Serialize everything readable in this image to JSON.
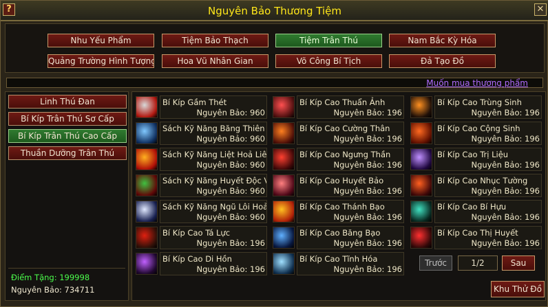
{
  "window": {
    "title": "Nguyên Bảo Thương Tiệm",
    "help_label": "?",
    "close_label": "✕"
  },
  "tabs": [
    {
      "label": "Nhu Yếu Phẩm",
      "active": false
    },
    {
      "label": "Tiệm Bảo Thạch",
      "active": false
    },
    {
      "label": "Tiệm Trân Thú",
      "active": true
    },
    {
      "label": "Nam Bắc Kỳ Hóa",
      "active": false
    },
    {
      "label": "Quảng Trường Hình Tượng",
      "active": false
    },
    {
      "label": "Hoa Vũ Nhân Gian",
      "active": false
    },
    {
      "label": "Võ Công Bí Tịch",
      "active": false
    },
    {
      "label": "Đả Tạo Đồ",
      "active": false
    }
  ],
  "notice": "Muốn mua thương phẩm",
  "categories": [
    {
      "label": "Linh Thú Đan",
      "active": false
    },
    {
      "label": "Bí Kíp Trân Thú Sơ Cấp",
      "active": false
    },
    {
      "label": "Bí Kíp Trân Thú Cao Cấp",
      "active": true
    },
    {
      "label": "Thuần Dưỡng Trân Thú",
      "active": false
    }
  ],
  "stats": {
    "diem_tang": "Điểm Tặng: 199998",
    "nguyen_bao": "Nguyên Bảo: 734711"
  },
  "items": [
    {
      "name": "Bí Kíp Gầm Thét",
      "price": "Nguyên Bảo: 960",
      "icon": "roar-icon",
      "colors": [
        "#d8d8d8",
        "#b01810"
      ]
    },
    {
      "name": "Bí Kíp Cao Thuẩn Ảnh",
      "price": "Nguyên Bảo: 196",
      "icon": "red-swirl-icon",
      "colors": [
        "#ff5050",
        "#501010"
      ]
    },
    {
      "name": "Bí Kíp Cao Trùng Sinh",
      "price": "Nguyên Bảo: 196",
      "icon": "rebirth-icon",
      "colors": [
        "#ff9020",
        "#201008"
      ]
    },
    {
      "name": "Sách Kỹ Năng Băng Thiên Tr",
      "price": "Nguyên Bảo: 960",
      "icon": "ice-sky-icon",
      "colors": [
        "#80c8ff",
        "#103060"
      ]
    },
    {
      "name": "Bí Kíp Cao Cường Thân",
      "price": "Nguyên Bảo: 196",
      "icon": "strong-body-icon",
      "colors": [
        "#ff8020",
        "#501008"
      ]
    },
    {
      "name": "Bí Kíp Cao Cộng Sinh",
      "price": "Nguyên Bảo: 196",
      "icon": "symbiosis-icon",
      "colors": [
        "#ff6a20",
        "#601000"
      ]
    },
    {
      "name": "Sách Kỹ Năng Liệt Hoả Liêu",
      "price": "Nguyên Bảo: 960",
      "icon": "fire-icon",
      "colors": [
        "#ffb020",
        "#b01008"
      ]
    },
    {
      "name": "Bí Kíp Cao Ngưng Thần",
      "price": "Nguyên Bảo: 196",
      "icon": "focus-icon",
      "colors": [
        "#ff4030",
        "#400808"
      ]
    },
    {
      "name": "Bí Kíp Cao Trị Liệu",
      "price": "Nguyên Bảo: 196",
      "icon": "heal-icon",
      "colors": [
        "#c090ff",
        "#200840"
      ]
    },
    {
      "name": "Sách Kỹ Năng Huyết Độc Vạn",
      "price": "Nguyên Bảo: 960",
      "icon": "poison-claw-icon",
      "colors": [
        "#40c040",
        "#600808"
      ]
    },
    {
      "name": "Bí Kíp Cao Huyết Bảo",
      "price": "Nguyên Bảo: 196",
      "icon": "blood-storm-icon",
      "colors": [
        "#ff8080",
        "#500818"
      ]
    },
    {
      "name": "Bí Kíp Cao Nhục Tường",
      "price": "Nguyên Bảo: 196",
      "icon": "flesh-wall-icon",
      "colors": [
        "#ff6020",
        "#400808"
      ]
    },
    {
      "name": "Sách Kỹ Năng Ngũ Lôi Hoản",
      "price": "Nguyên Bảo: 960",
      "icon": "thunder-icon",
      "colors": [
        "#e0e8ff",
        "#182050"
      ]
    },
    {
      "name": "Bí Kíp Cao Thánh Bạo",
      "price": "Nguyên Bảo: 196",
      "icon": "holy-burst-icon",
      "colors": [
        "#ffc020",
        "#b02008"
      ]
    },
    {
      "name": "Bí Kíp Cao Bí Hựu",
      "price": "Nguyên Bảo: 196",
      "icon": "blessing-icon",
      "colors": [
        "#40e0c0",
        "#082820"
      ]
    },
    {
      "name": "Bí Kíp Cao Tá Lực",
      "price": "Nguyên Bảo: 196",
      "icon": "borrow-power-icon",
      "colors": [
        "#e02010",
        "#301008"
      ]
    },
    {
      "name": "Bí Kíp Cao Băng Bạo",
      "price": "Nguyên Bảo: 196",
      "icon": "ice-burst-icon",
      "colors": [
        "#60b0ff",
        "#081840"
      ]
    },
    {
      "name": "Bí Kíp Cao Thị Huyết",
      "price": "Nguyên Bảo: 196",
      "icon": "bloodthirst-icon",
      "colors": [
        "#ff3030",
        "#300808"
      ]
    },
    {
      "name": "Bí Kíp Cao Di Hồn",
      "price": "Nguyên Bảo: 196",
      "icon": "soul-shift-icon",
      "colors": [
        "#c060ff",
        "#200830"
      ]
    },
    {
      "name": "Bí Kíp Cao Tĩnh Hóa",
      "price": "Nguyên Bảo: 196",
      "icon": "purify-icon",
      "colors": [
        "#a0e0ff",
        "#103050"
      ]
    }
  ],
  "pager": {
    "prev_label": "Trước",
    "page": "1/2",
    "next_label": "Sau"
  },
  "khu_label": "Khu Thử Đồ"
}
